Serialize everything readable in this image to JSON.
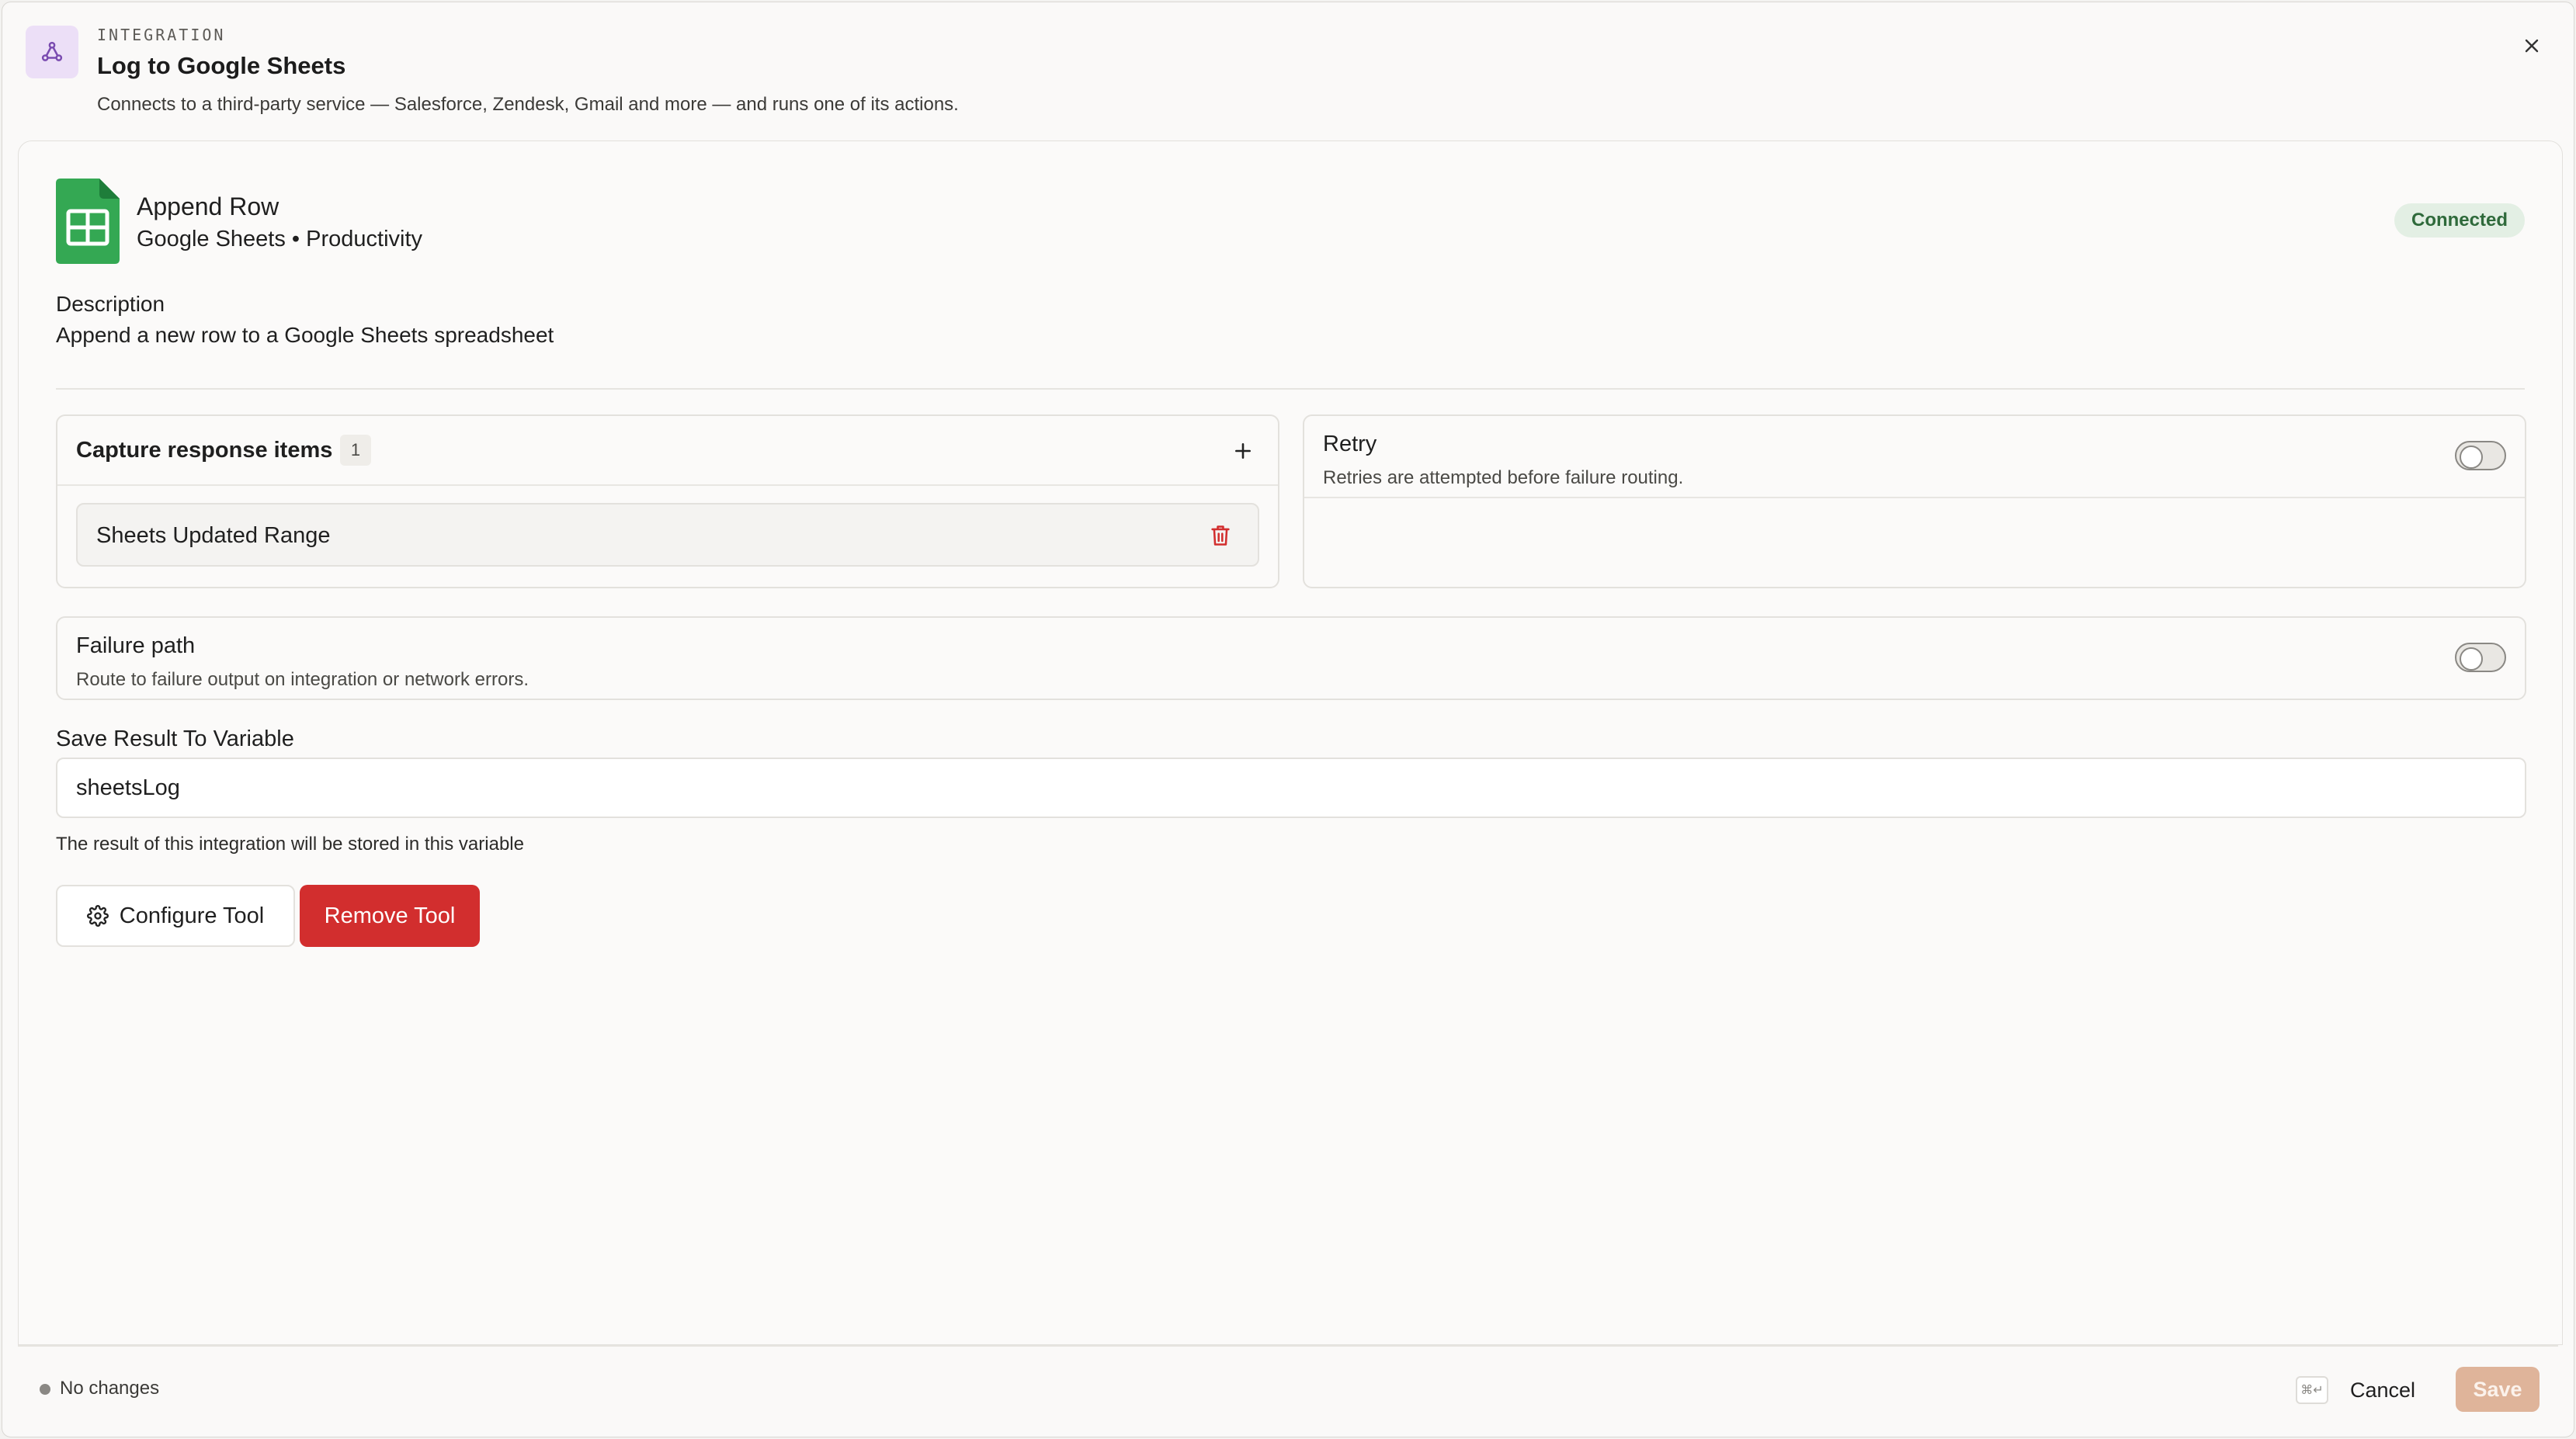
{
  "header": {
    "kicker": "INTEGRATION",
    "title": "Log to Google Sheets",
    "description": "Connects to a third-party service — Salesforce, Zendesk, Gmail and more — and runs one of its actions."
  },
  "tool": {
    "name": "Append Row",
    "meta": "Google Sheets • Productivity",
    "status": "Connected",
    "description_label": "Description",
    "description": "Append a new row to a Google Sheets spreadsheet"
  },
  "capture": {
    "title": "Capture response items",
    "count": "1",
    "items": [
      {
        "label": "Sheets Updated Range"
      }
    ]
  },
  "retry": {
    "title": "Retry",
    "subtitle": "Retries are attempted before failure routing.",
    "enabled": false
  },
  "failure": {
    "title": "Failure path",
    "subtitle": "Route to failure output on integration or network errors.",
    "enabled": false
  },
  "variable": {
    "label": "Save Result To Variable",
    "value": "sheetsLog",
    "help": "The result of this integration will be stored in this variable"
  },
  "actions": {
    "configure_label": "Configure Tool",
    "remove_label": "Remove Tool"
  },
  "footer": {
    "status": "No changes",
    "kbd": "⌘↵",
    "cancel_label": "Cancel",
    "save_label": "Save"
  },
  "colors": {
    "accent": "#dfb49a",
    "danger": "#d22e2e",
    "connected_bg": "#e3efe4",
    "connected_text": "#2f6a3b",
    "sheets_green": "#34a853"
  }
}
